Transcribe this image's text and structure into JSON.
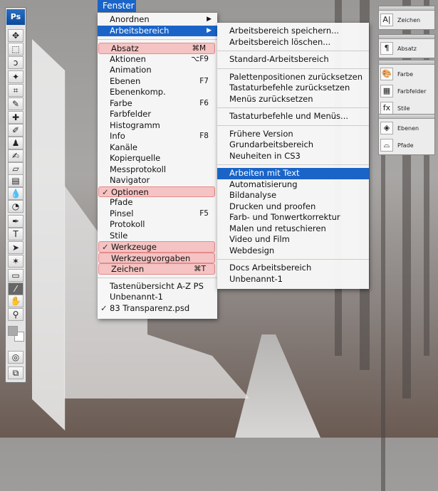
{
  "menubar": {
    "active": "Fenster"
  },
  "fenster_menu": [
    {
      "label": "Anordnen",
      "submenu": true
    },
    {
      "label": "Arbeitsbereich",
      "submenu": true,
      "highlight": true
    },
    {
      "sep": true
    },
    {
      "label": "Absatz",
      "shortcut": "⌘M",
      "red": true
    },
    {
      "label": "Aktionen",
      "shortcut": "⌥F9"
    },
    {
      "label": "Animation"
    },
    {
      "label": "Ebenen",
      "shortcut": "F7"
    },
    {
      "label": "Ebenenkomp."
    },
    {
      "label": "Farbe",
      "shortcut": "F6"
    },
    {
      "label": "Farbfelder"
    },
    {
      "label": "Histogramm"
    },
    {
      "label": "Info",
      "shortcut": "F8"
    },
    {
      "label": "Kanäle"
    },
    {
      "label": "Kopierquelle"
    },
    {
      "label": "Messprotokoll"
    },
    {
      "label": "Navigator"
    },
    {
      "label": "Optionen",
      "checked": true,
      "red": true
    },
    {
      "label": "Pfade"
    },
    {
      "label": "Pinsel",
      "shortcut": "F5"
    },
    {
      "label": "Protokoll"
    },
    {
      "label": "Stile"
    },
    {
      "label": "Werkzeuge",
      "checked": true,
      "red": true
    },
    {
      "label": "Werkzeugvorgaben",
      "red": true
    },
    {
      "label": "Zeichen",
      "shortcut": "⌘T",
      "red": true
    },
    {
      "sep": true
    },
    {
      "label": "Tastenübersicht A-Z PS"
    },
    {
      "label": "Unbenannt-1"
    },
    {
      "label": "83 Transparenz.psd",
      "checked": true
    }
  ],
  "arbeitsbereich_submenu": [
    {
      "label": "Arbeitsbereich speichern..."
    },
    {
      "label": "Arbeitsbereich löschen..."
    },
    {
      "sep": true
    },
    {
      "label": "Standard-Arbeitsbereich"
    },
    {
      "sep": true
    },
    {
      "label": "Palettenpositionen zurücksetzen"
    },
    {
      "label": "Tastaturbefehle zurücksetzen"
    },
    {
      "label": "Menüs zurücksetzen"
    },
    {
      "sep": true
    },
    {
      "label": "Tastaturbefehle und Menüs..."
    },
    {
      "sep": true
    },
    {
      "label": "Frühere Version"
    },
    {
      "label": "Grundarbeitsbereich"
    },
    {
      "label": "Neuheiten in CS3"
    },
    {
      "sep": true
    },
    {
      "label": "Arbeiten mit Text",
      "highlight": true
    },
    {
      "label": "Automatisierung"
    },
    {
      "label": "Bildanalyse"
    },
    {
      "label": "Drucken und proofen"
    },
    {
      "label": "Farb- und Tonwertkorrektur"
    },
    {
      "label": "Malen und retuschieren"
    },
    {
      "label": "Video und Film"
    },
    {
      "label": "Webdesign"
    },
    {
      "sep": true
    },
    {
      "label": "Docs Arbeitsbereich"
    },
    {
      "label": "Unbenannt-1"
    }
  ],
  "toolbar": {
    "logo": "Ps",
    "tools": [
      {
        "name": "move",
        "glyph": "✥"
      },
      {
        "name": "marquee",
        "glyph": "⬚"
      },
      {
        "name": "lasso",
        "glyph": "ↄ"
      },
      {
        "name": "magic-wand",
        "glyph": "✦"
      },
      {
        "name": "crop",
        "glyph": "⌗"
      },
      {
        "name": "slice",
        "glyph": "✎"
      },
      {
        "name": "healing-brush",
        "glyph": "✚"
      },
      {
        "name": "brush",
        "glyph": "✐"
      },
      {
        "name": "clone-stamp",
        "glyph": "♟"
      },
      {
        "name": "history-brush",
        "glyph": "✍"
      },
      {
        "name": "eraser",
        "glyph": "▱"
      },
      {
        "name": "gradient",
        "glyph": "▤"
      },
      {
        "name": "blur",
        "glyph": "💧"
      },
      {
        "name": "dodge",
        "glyph": "◔"
      },
      {
        "name": "pen",
        "glyph": "✒"
      },
      {
        "name": "type",
        "glyph": "T"
      },
      {
        "name": "path-selection",
        "glyph": "➤"
      },
      {
        "name": "custom-shape",
        "glyph": "✶"
      },
      {
        "name": "notes",
        "glyph": "▭"
      },
      {
        "name": "eyedropper",
        "glyph": "⁄",
        "selected": true
      },
      {
        "name": "hand",
        "glyph": "✋"
      },
      {
        "name": "zoom",
        "glyph": "⚲"
      },
      {
        "name": "quick-mask",
        "glyph": "◎"
      },
      {
        "name": "screen-mode",
        "glyph": "⧉"
      }
    ]
  },
  "panels": [
    {
      "items": [
        {
          "label": "Zeichen",
          "icon": "A|"
        }
      ]
    },
    {
      "items": [
        {
          "label": "Absatz",
          "icon": "¶"
        }
      ]
    },
    {
      "items": [
        {
          "label": "Farbe",
          "icon": "🎨"
        },
        {
          "label": "Farbfelder",
          "icon": "▦"
        },
        {
          "label": "Stile",
          "icon": "fx"
        }
      ]
    },
    {
      "items": [
        {
          "label": "Ebenen",
          "icon": "◈"
        },
        {
          "label": "Pfade",
          "icon": "⌓"
        }
      ]
    }
  ],
  "colors": {
    "highlight": "#1a64c8",
    "red_mark": "#f5c3c3"
  }
}
